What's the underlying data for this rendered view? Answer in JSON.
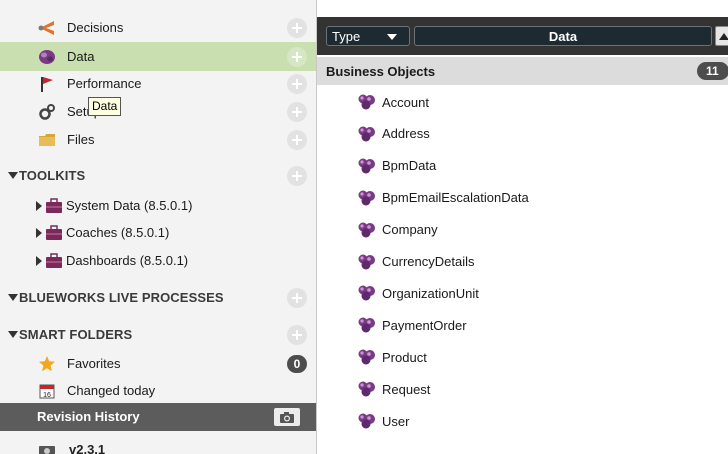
{
  "nav": {
    "decisions": "Decisions",
    "data": "Data",
    "performance": "Performance",
    "setup": "Setup",
    "files": "Files"
  },
  "tooltip": "Data",
  "toolkits": {
    "header": "TOOLKITS",
    "items": [
      "System Data (8.5.0.1)",
      "Coaches (8.5.0.1)",
      "Dashboards (8.5.0.1)"
    ]
  },
  "blueworks": {
    "header": "BLUEWORKS LIVE PROCESSES"
  },
  "smart_folders": {
    "header": "SMART FOLDERS",
    "favorites": "Favorites",
    "favorites_count": "0",
    "changed_today": "Changed today",
    "calendar_day": "16"
  },
  "revision": {
    "title": "Revision History",
    "item": "v2.3.1"
  },
  "panel": {
    "type_label": "Type",
    "title": "Data",
    "section": "Business Objects",
    "count": "11",
    "objects": [
      "Account",
      "Address",
      "BpmData",
      "BpmEmailEscalationData",
      "Company",
      "CurrencyDetails",
      "OrganizationUnit",
      "PaymentOrder",
      "Product",
      "Request",
      "User"
    ]
  },
  "colors": {
    "selected_row": "#c9dfb0",
    "dark_header": "#333333",
    "badge": "#4d4d4d",
    "object_icon": "#7a3a86"
  },
  "icons": {
    "decisions": "decisions-icon",
    "data": "data-icon",
    "performance": "flag-icon",
    "setup": "gears-icon",
    "files": "folder-icon",
    "toolkit": "toolkit-icon",
    "favorites": "star-icon",
    "changed_today": "calendar-icon",
    "revision": "camera-icon",
    "business_object": "business-object-icon"
  }
}
